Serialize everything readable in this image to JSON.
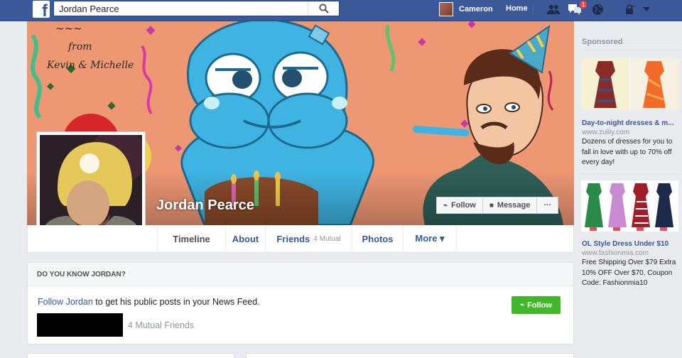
{
  "topbar": {
    "search_value": "Jordan Pearce",
    "profile_name": "Cameron",
    "home_label": "Home",
    "notification_count": "1"
  },
  "profile": {
    "name": "Jordan Pearce",
    "cover_text_from": "from",
    "cover_text_names": "Kevin & Michelle",
    "follow_label": "Follow",
    "message_label": "Message",
    "more_label": "···"
  },
  "tabs": [
    {
      "label": "Timeline"
    },
    {
      "label": "About"
    },
    {
      "label": "Friends",
      "sub": "4 Mutual"
    },
    {
      "label": "Photos"
    },
    {
      "label": "More ▾"
    }
  ],
  "dyk": {
    "heading": "DO YOU KNOW JORDAN?",
    "link": "Follow Jordan",
    "text": " to get his public posts in your News Feed.",
    "follow_label": "Follow",
    "mutual": "4 Mutual Friends"
  },
  "sponsored": {
    "heading": "Sponsored",
    "ads": [
      {
        "title": "Day-to-night dresses & m...",
        "domain": "www.zulily.com",
        "desc": "Dozens of dresses for you to fall in love with up to 70% off every day!"
      },
      {
        "title": "OL Style Dress Under $10",
        "domain": "www.fashionmia.com",
        "desc": "Free Shipping Over $79 Extra 10% OFF Over $70, Coupon Code: Fashionmia10"
      }
    ]
  },
  "colors": {
    "brand": "#3b5998",
    "link": "#365899",
    "green": "#42b72a",
    "cover_bg": "#ee9773",
    "character_blue": "#3fb4e3"
  }
}
